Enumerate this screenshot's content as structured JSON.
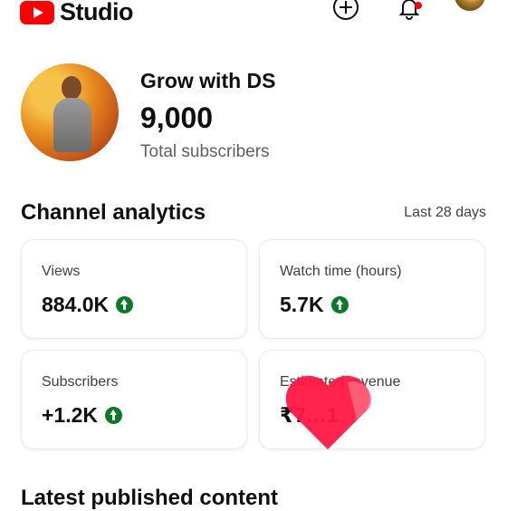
{
  "app": {
    "logo_text": "Studio"
  },
  "channel": {
    "name": "Grow with DS",
    "subscriber_count": "9,000",
    "subscriber_label": "Total subscribers"
  },
  "analytics": {
    "title": "Channel analytics",
    "period": "Last 28 days",
    "cards": [
      {
        "label": "Views",
        "value": "884.0K",
        "trend": "up"
      },
      {
        "label": "Watch time (hours)",
        "value": "5.7K",
        "trend": "up"
      },
      {
        "label": "Subscribers",
        "value": "+1.2K",
        "trend": "up"
      },
      {
        "label": "Estimated revenue",
        "value": "₹7…1",
        "trend": "none"
      }
    ]
  },
  "latest": {
    "title": "Latest published content"
  },
  "colors": {
    "brand": "#ff0000",
    "trend_up": "#0b7a26",
    "heart": "#ff1744"
  }
}
